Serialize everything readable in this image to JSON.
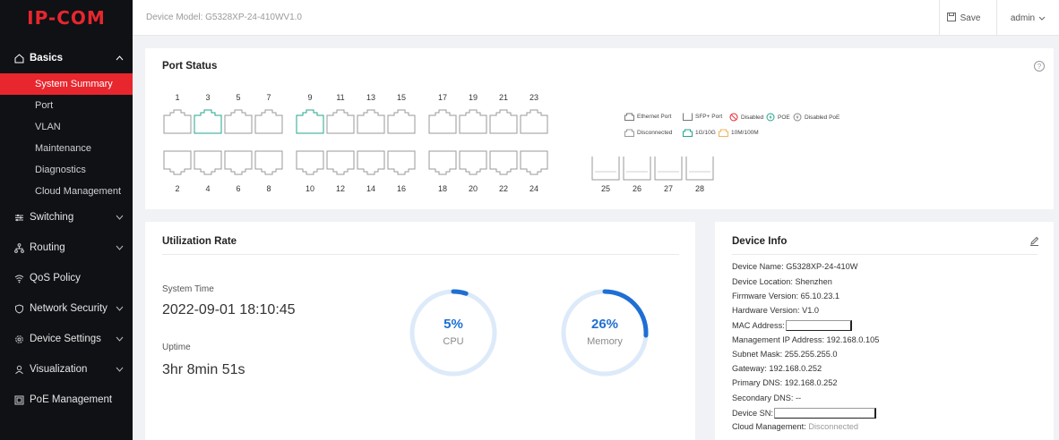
{
  "brand": {
    "logo_text": "IP-COM",
    "logo_color": "#e8262e"
  },
  "header": {
    "model": "Device Model: G5328XP-24-410WV1.0",
    "save_label": "Save",
    "user_label": "admin"
  },
  "sidebar": {
    "basics": {
      "label": "Basics",
      "items": [
        "System Summary",
        "Port",
        "VLAN",
        "Maintenance",
        "Diagnostics",
        "Cloud Management"
      ],
      "active": "System Summary"
    },
    "groups": [
      {
        "label": "Switching",
        "icon": "switching-icon",
        "expandable": true
      },
      {
        "label": "Routing",
        "icon": "routing-icon",
        "expandable": true
      },
      {
        "label": "QoS Policy",
        "icon": "qos-icon",
        "expandable": false
      },
      {
        "label": "Network Security",
        "icon": "shield-icon",
        "expandable": true
      },
      {
        "label": "Device Settings",
        "icon": "gear-icon",
        "expandable": true
      },
      {
        "label": "Visualization",
        "icon": "visualization-icon",
        "expandable": true
      },
      {
        "label": "PoE Management",
        "icon": "poe-icon",
        "expandable": false
      }
    ]
  },
  "port_status": {
    "title": "Port Status",
    "top_ports": [
      "1",
      "3",
      "5",
      "7",
      "9",
      "11",
      "13",
      "15",
      "17",
      "19",
      "21",
      "23"
    ],
    "bottom_ports": [
      "2",
      "4",
      "6",
      "8",
      "10",
      "12",
      "14",
      "16",
      "18",
      "20",
      "22",
      "24"
    ],
    "sfp_ports": [
      "25",
      "26",
      "27",
      "28"
    ],
    "connected_ports": [
      "3",
      "9"
    ],
    "legend": {
      "ethernet": "Ethernet Port",
      "sfp": "SFP+ Port",
      "disabled": "Disabled",
      "poe": "POE",
      "disabled_poe": "Disabled PoE",
      "disconnected": "Disconnected",
      "g1_10": "1G/10G",
      "m10_100": "10M/100M"
    },
    "colors": {
      "connected": "#23a58d",
      "disconnected": "#9a9a9a",
      "slow": "#f0b35a",
      "disabled": "#e8262e",
      "poe": "#23a58d"
    }
  },
  "utilization": {
    "title": "Utilization Rate",
    "system_time_label": "System Time",
    "system_time": "2022-09-01 18:10:45",
    "uptime_label": "Uptime",
    "uptime": "3hr 8min 51s",
    "cpu": {
      "value": 5,
      "value_text": "5%",
      "label": "CPU"
    },
    "memory": {
      "value": 26,
      "value_text": "26%",
      "label": "Memory"
    },
    "colors": {
      "arc": "#1f6fd3",
      "track": "#dceaf9"
    }
  },
  "device_info": {
    "title": "Device Info",
    "device_name": "Device Name: G5328XP-24-410W",
    "device_location": "Device Location: Shenzhen",
    "firmware": "Firmware Version: 65.10.23.1",
    "hardware": "Hardware Version: V1.0",
    "mac_label": "MAC Address:",
    "mgmt_ip": "Management IP Address: 192.168.0.105",
    "subnet": "Subnet Mask: 255.255.255.0",
    "gateway": "Gateway: 192.168.0.252",
    "primary_dns": "Primary DNS: 192.168.0.252",
    "secondary_dns": "Secondary DNS: --",
    "sn_label": "Device SN:",
    "cloud_label": "Cloud Management:",
    "cloud_status": "Disconnected"
  }
}
